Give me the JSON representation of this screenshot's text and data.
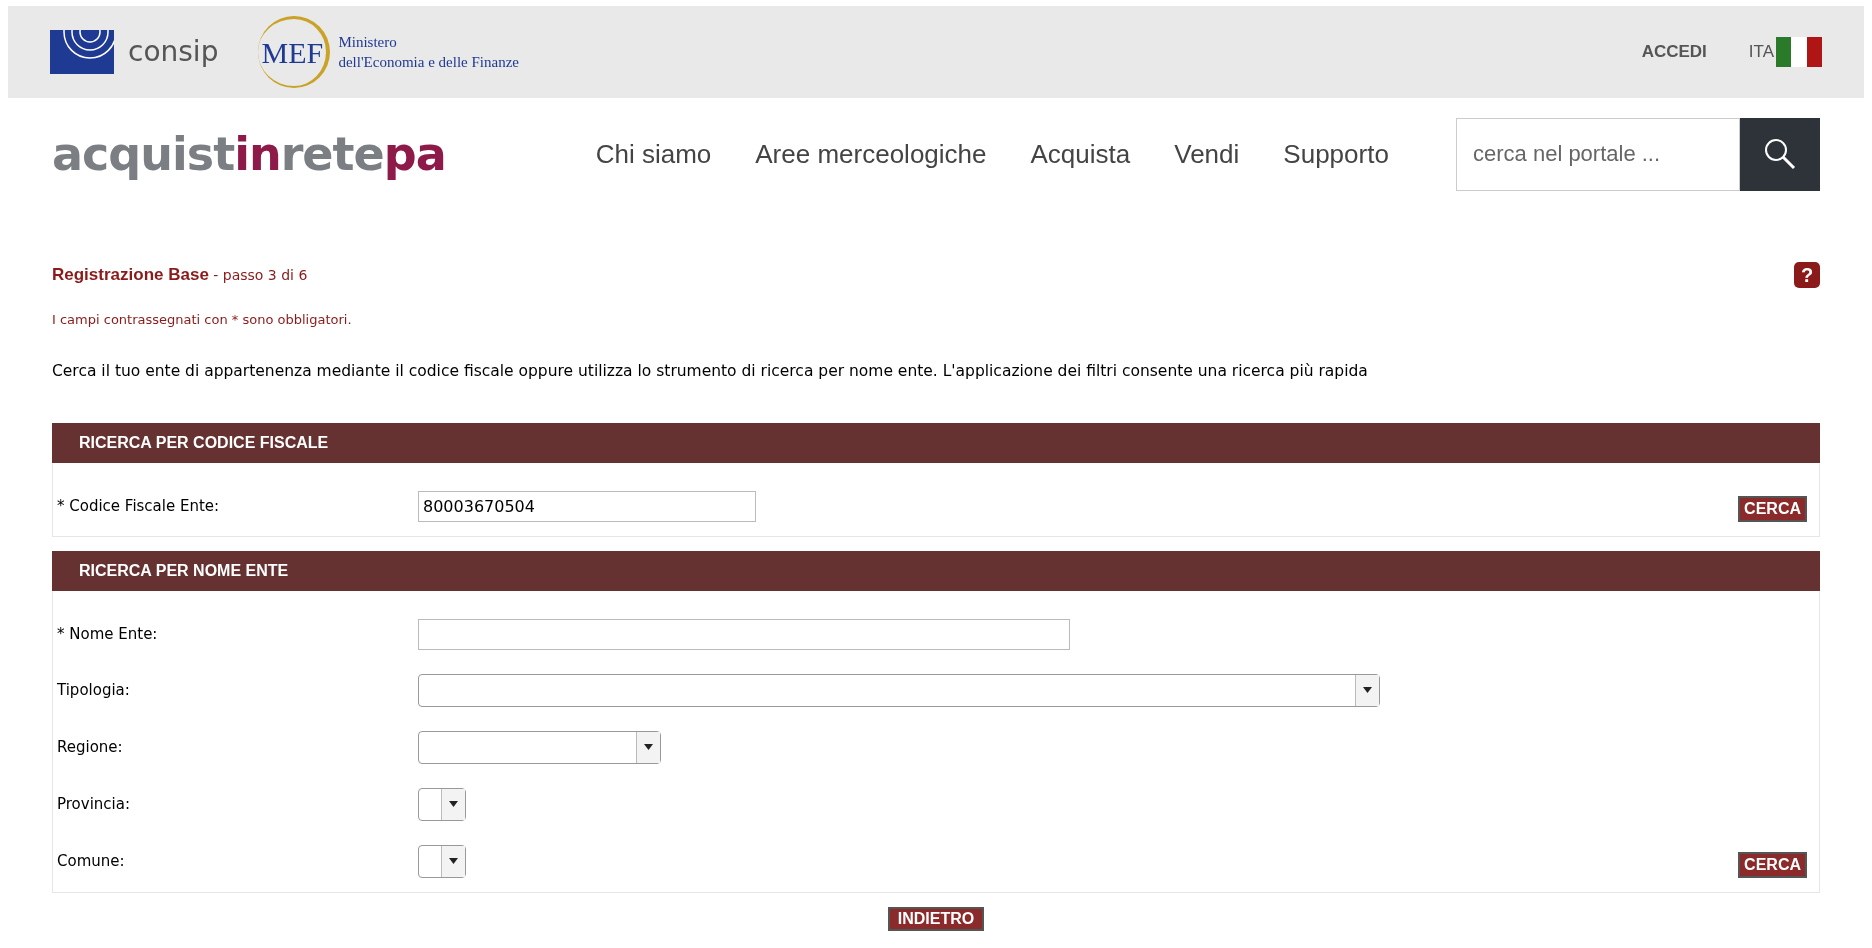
{
  "top_bar": {
    "consip": "consip",
    "mef_mark": "MEF",
    "mef_line1": "Ministero",
    "mef_line2": "dell'Economia e delle Finanze",
    "login": "ACCEDI",
    "language": "ITA"
  },
  "header": {
    "logo_parts": [
      {
        "text": "acquist",
        "kind": "gray"
      },
      {
        "text": "in",
        "kind": "accent"
      },
      {
        "text": "rete",
        "kind": "gray"
      },
      {
        "text": "pa",
        "kind": "accent"
      }
    ],
    "nav": [
      "Chi siamo",
      "Aree merceologiche",
      "Acquista",
      "Vendi",
      "Supporto"
    ],
    "search": {
      "placeholder": "cerca nel portale ..."
    }
  },
  "page": {
    "title": "Registrazione Base",
    "step": " - passo 3 di 6",
    "required_note": "I campi contrassegnati con * sono obbligatori.",
    "intro": "Cerca il tuo ente di appartenenza mediante il codice fiscale oppure utilizza lo strumento di ricerca per nome ente. L'applicazione dei filtri consente una ricerca più rapida",
    "help": "?"
  },
  "sections": [
    {
      "title": "RICERCA PER CODICE FISCALE",
      "button": "CERCA",
      "fields": [
        {
          "label": "* Codice Fiscale Ente:",
          "kind": "text",
          "value": "80003670504"
        }
      ]
    },
    {
      "title": "RICERCA PER NOME ENTE",
      "button": "CERCA",
      "fields": [
        {
          "label": "* Nome Ente:",
          "kind": "text"
        },
        {
          "label": "Tipologia:",
          "kind": "select"
        },
        {
          "label": "Regione:",
          "kind": "select"
        },
        {
          "label": "Provincia:",
          "kind": "select"
        },
        {
          "label": "Comune:",
          "kind": "select"
        }
      ]
    }
  ],
  "back_button": "INDIETRO"
}
